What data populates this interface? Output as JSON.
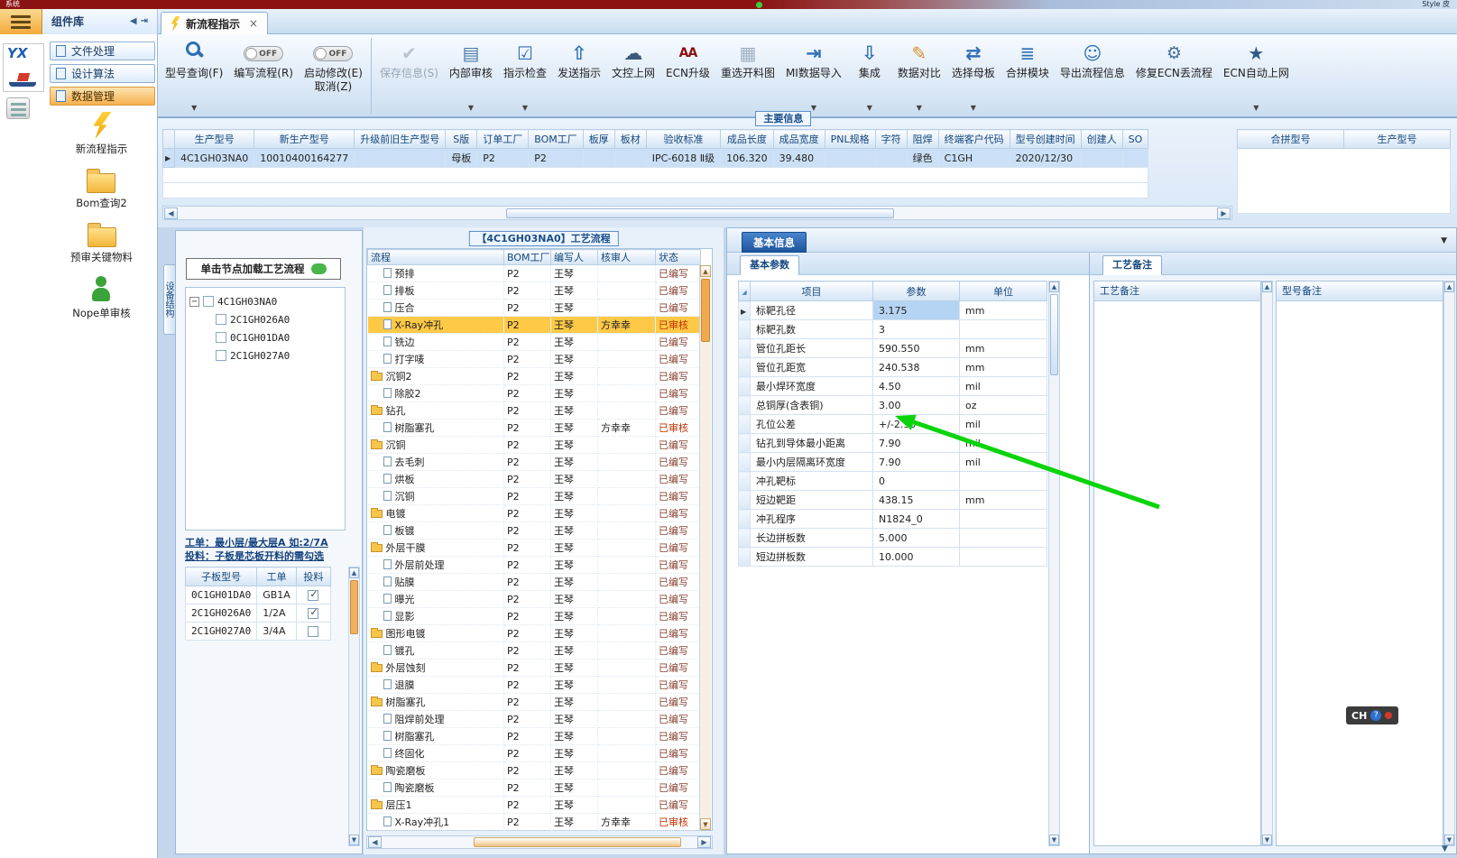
{
  "titlebar": {
    "system_label": "系统",
    "style_label": "Style 皮"
  },
  "tabbar": {
    "panel_title": "组件库",
    "active_tab": "新流程指示"
  },
  "toolbar": {
    "buttons": [
      {
        "label": "型号查询(F)",
        "icon": "search",
        "dropdown": true
      },
      {
        "label": "编写流程(R)",
        "icon": "toggle",
        "toggle": "OFF"
      },
      {
        "label": "启动修改(E)",
        "label2": "取消(Z)",
        "icon": "toggle",
        "toggle": "OFF",
        "sep": true
      },
      {
        "label": "保存信息(S)",
        "icon": "check",
        "disabled": true
      },
      {
        "label": "内部审核",
        "icon": "printer",
        "dropdown": true
      },
      {
        "label": "指示检查",
        "icon": "checkbox",
        "dropdown": true
      },
      {
        "label": "发送指示",
        "icon": "send"
      },
      {
        "label": "文控上网",
        "icon": "cloud"
      },
      {
        "label": "ECN升级",
        "icon": "font"
      },
      {
        "label": "重选开料图",
        "icon": "image"
      },
      {
        "label": "MI数据导入",
        "icon": "import",
        "dropdown": true
      },
      {
        "label": "集成",
        "icon": "download",
        "dropdown": true
      },
      {
        "label": "数据对比",
        "icon": "compare",
        "dropdown": true
      },
      {
        "label": "选择母板",
        "icon": "shuffle",
        "dropdown": true
      },
      {
        "label": "合拼模块",
        "icon": "list"
      },
      {
        "label": "导出流程信息",
        "icon": "smiley"
      },
      {
        "label": "修复ECN丢流程",
        "icon": "wrench"
      },
      {
        "label": "ECN自动上网",
        "icon": "star",
        "dropdown": true
      }
    ]
  },
  "sidebar": {
    "logo_text": "YX",
    "nav": [
      {
        "label": "文件处理"
      },
      {
        "label": "设计算法"
      },
      {
        "label": "数据管理",
        "active": true
      }
    ],
    "items": [
      {
        "label": "新流程指示",
        "icon": "lightning"
      },
      {
        "label": "Bom查询2",
        "icon": "folder"
      },
      {
        "label": "预审关键物料",
        "icon": "folder"
      },
      {
        "label": "Nope单审核",
        "icon": "person"
      }
    ]
  },
  "main_grid": {
    "legend": "主要信息",
    "columns": [
      "生产型号",
      "新生产型号",
      "升级前旧生产型号",
      "S版",
      "订单工厂",
      "BOM工厂",
      "板厚",
      "板材",
      "验收标准",
      "成品长度",
      "成品宽度",
      "PNL规格",
      "字符",
      "阻焊",
      "终端客户代码",
      "型号创建时间",
      "创建人",
      "SO"
    ],
    "row": [
      "4C1GH03NA0",
      "10010400164277",
      "",
      "母板",
      "P2",
      "P2",
      "",
      "",
      "IPC-6018 Ⅱ级",
      "106.320",
      "39.480",
      "",
      "",
      "绿色",
      "C1GH",
      "2020/12/30",
      "",
      ""
    ],
    "right_columns": [
      "合拼型号",
      "生产型号"
    ]
  },
  "device_panel": {
    "vertical_tab": "设备结构",
    "load_button": "单击节点加载工艺流程",
    "tree": [
      {
        "label": "4C1GH03NA0",
        "indent": 0,
        "root": true
      },
      {
        "label": "2C1GH026A0",
        "indent": 1
      },
      {
        "label": "0C1GH01DA0",
        "indent": 1
      },
      {
        "label": "2C1GH027A0",
        "indent": 1
      }
    ],
    "hint1": "工单：最小层/最大层A 如:2/7A",
    "hint2": "投料：子板是芯板开料的需勾选",
    "columns": [
      "子板型号",
      "工单",
      "投料"
    ],
    "rows": [
      {
        "model": "0C1GH01DA0",
        "order": "GB1A",
        "checked": true
      },
      {
        "model": "2C1GH026A0",
        "order": "1/2A",
        "checked": true
      },
      {
        "model": "2C1GH027A0",
        "order": "3/4A",
        "checked": false
      }
    ]
  },
  "process_panel": {
    "title": "【4C1GH03NA0】工艺流程",
    "columns": [
      "流程",
      "BOM工厂",
      "编写人",
      "核审人",
      "状态"
    ],
    "rows": [
      {
        "label": "预排",
        "type": "file",
        "indent": 1,
        "factory": "P2",
        "writer": "王琴",
        "reviewer": "",
        "status": "已编写"
      },
      {
        "label": "排板",
        "type": "file",
        "indent": 1,
        "factory": "P2",
        "writer": "王琴",
        "reviewer": "",
        "status": "已编写"
      },
      {
        "label": "压合",
        "type": "file",
        "indent": 1,
        "factory": "P2",
        "writer": "王琴",
        "reviewer": "",
        "status": "已编写"
      },
      {
        "label": "X-Ray冲孔",
        "type": "file",
        "indent": 1,
        "factory": "P2",
        "writer": "王琴",
        "reviewer": "方幸幸",
        "status": "已审核",
        "audited": true,
        "selected": true
      },
      {
        "label": "铣边",
        "type": "file",
        "indent": 1,
        "factory": "P2",
        "writer": "王琴",
        "reviewer": "",
        "status": "已编写"
      },
      {
        "label": "打字唛",
        "type": "file",
        "indent": 1,
        "factory": "P2",
        "writer": "王琴",
        "reviewer": "",
        "status": "已编写"
      },
      {
        "label": "沉铜2",
        "type": "folder",
        "indent": 0,
        "factory": "P2",
        "writer": "王琴",
        "reviewer": "",
        "status": "已编写"
      },
      {
        "label": "除胶2",
        "type": "file",
        "indent": 1,
        "factory": "P2",
        "writer": "王琴",
        "reviewer": "",
        "status": "已编写"
      },
      {
        "label": "钻孔",
        "type": "folder",
        "indent": 0,
        "factory": "P2",
        "writer": "王琴",
        "reviewer": "",
        "status": "已编写"
      },
      {
        "label": "树脂塞孔",
        "type": "file",
        "indent": 1,
        "factory": "P2",
        "writer": "王琴",
        "reviewer": "方幸幸",
        "status": "已审核",
        "audited": true
      },
      {
        "label": "沉铜",
        "type": "folder",
        "indent": 0,
        "factory": "P2",
        "writer": "王琴",
        "reviewer": "",
        "status": "已编写"
      },
      {
        "label": "去毛刺",
        "type": "file",
        "indent": 1,
        "factory": "P2",
        "writer": "王琴",
        "reviewer": "",
        "status": "已编写"
      },
      {
        "label": "烘板",
        "type": "file",
        "indent": 1,
        "factory": "P2",
        "writer": "王琴",
        "reviewer": "",
        "status": "已编写"
      },
      {
        "label": "沉铜",
        "type": "file",
        "indent": 1,
        "factory": "P2",
        "writer": "王琴",
        "reviewer": "",
        "status": "已编写"
      },
      {
        "label": "电镀",
        "type": "folder",
        "indent": 0,
        "factory": "P2",
        "writer": "王琴",
        "reviewer": "",
        "status": "已编写"
      },
      {
        "label": "板镀",
        "type": "file",
        "indent": 1,
        "factory": "P2",
        "writer": "王琴",
        "reviewer": "",
        "status": "已编写"
      },
      {
        "label": "外层干膜",
        "type": "folder",
        "indent": 0,
        "factory": "P2",
        "writer": "王琴",
        "reviewer": "",
        "status": "已编写"
      },
      {
        "label": "外层前处理",
        "type": "file",
        "indent": 1,
        "factory": "P2",
        "writer": "王琴",
        "reviewer": "",
        "status": "已编写"
      },
      {
        "label": "贴膜",
        "type": "file",
        "indent": 1,
        "factory": "P2",
        "writer": "王琴",
        "reviewer": "",
        "status": "已编写"
      },
      {
        "label": "曝光",
        "type": "file",
        "indent": 1,
        "factory": "P2",
        "writer": "王琴",
        "reviewer": "",
        "status": "已编写"
      },
      {
        "label": "显影",
        "type": "file",
        "indent": 1,
        "factory": "P2",
        "writer": "王琴",
        "reviewer": "",
        "status": "已编写"
      },
      {
        "label": "图形电镀",
        "type": "folder",
        "indent": 0,
        "factory": "P2",
        "writer": "王琴",
        "reviewer": "",
        "status": "已编写"
      },
      {
        "label": "镀孔",
        "type": "file",
        "indent": 1,
        "factory": "P2",
        "writer": "王琴",
        "reviewer": "",
        "status": "已编写"
      },
      {
        "label": "外层蚀刻",
        "type": "folder",
        "indent": 0,
        "factory": "P2",
        "writer": "王琴",
        "reviewer": "",
        "status": "已编写"
      },
      {
        "label": "退膜",
        "type": "file",
        "indent": 1,
        "factory": "P2",
        "writer": "王琴",
        "reviewer": "",
        "status": "已编写"
      },
      {
        "label": "树脂塞孔",
        "type": "folder",
        "indent": 0,
        "factory": "P2",
        "writer": "王琴",
        "reviewer": "",
        "status": "已编写"
      },
      {
        "label": "阻焊前处理",
        "type": "file",
        "indent": 1,
        "factory": "P2",
        "writer": "王琴",
        "reviewer": "",
        "status": "已编写"
      },
      {
        "label": "树脂塞孔",
        "type": "file",
        "indent": 1,
        "factory": "P2",
        "writer": "王琴",
        "reviewer": "",
        "status": "已编写"
      },
      {
        "label": "终固化",
        "type": "file",
        "indent": 1,
        "factory": "P2",
        "writer": "王琴",
        "reviewer": "",
        "status": "已编写"
      },
      {
        "label": "陶瓷磨板",
        "type": "folder",
        "indent": 0,
        "factory": "P2",
        "writer": "王琴",
        "reviewer": "",
        "status": "已编写"
      },
      {
        "label": "陶瓷磨板",
        "type": "file",
        "indent": 1,
        "factory": "P2",
        "writer": "王琴",
        "reviewer": "",
        "status": "已编写"
      },
      {
        "label": "层压1",
        "type": "folder",
        "indent": 0,
        "factory": "P2",
        "writer": "王琴",
        "reviewer": "",
        "status": "已编写"
      },
      {
        "label": "X-Ray冲孔1",
        "type": "file",
        "indent": 1,
        "factory": "P2",
        "writer": "王琴",
        "reviewer": "方幸幸",
        "status": "已审核",
        "audited": true
      }
    ]
  },
  "basic_panel": {
    "tab": "基本信息",
    "inner_tab": "基本参数",
    "columns": [
      "项目",
      "参数",
      "单位"
    ],
    "rows": [
      {
        "item": "标靶孔径",
        "value": "3.175",
        "unit": "mm",
        "selected": true
      },
      {
        "item": "标靶孔数",
        "value": "3",
        "unit": ""
      },
      {
        "item": "管位孔距长",
        "value": "590.550",
        "unit": "mm"
      },
      {
        "item": "管位孔距宽",
        "value": "240.538",
        "unit": "mm"
      },
      {
        "item": "最小焊环宽度",
        "value": "4.50",
        "unit": "mil"
      },
      {
        "item": "总铜厚(含表铜)",
        "value": "3.00",
        "unit": "oz"
      },
      {
        "item": "孔位公差",
        "value": "+/-2.90",
        "unit": "mil"
      },
      {
        "item": "钻孔到导体最小距离",
        "value": "7.90",
        "unit": "mil"
      },
      {
        "item": "最小内层隔离环宽度",
        "value": "7.90",
        "unit": "mil"
      },
      {
        "item": "冲孔靶标",
        "value": "0",
        "unit": ""
      },
      {
        "item": "短边靶距",
        "value": "438.15",
        "unit": "mm"
      },
      {
        "item": "冲孔程序",
        "value": "N1824_0",
        "unit": ""
      },
      {
        "item": "长边拼板数",
        "value": "5.000",
        "unit": ""
      },
      {
        "item": "短边拼板数",
        "value": "10.000",
        "unit": ""
      }
    ]
  },
  "notes_panel": {
    "tab": "工艺备注",
    "col1": "工艺备注",
    "col2": "型号备注"
  },
  "statusbar": {
    "lang": "CH",
    "help": "?"
  }
}
